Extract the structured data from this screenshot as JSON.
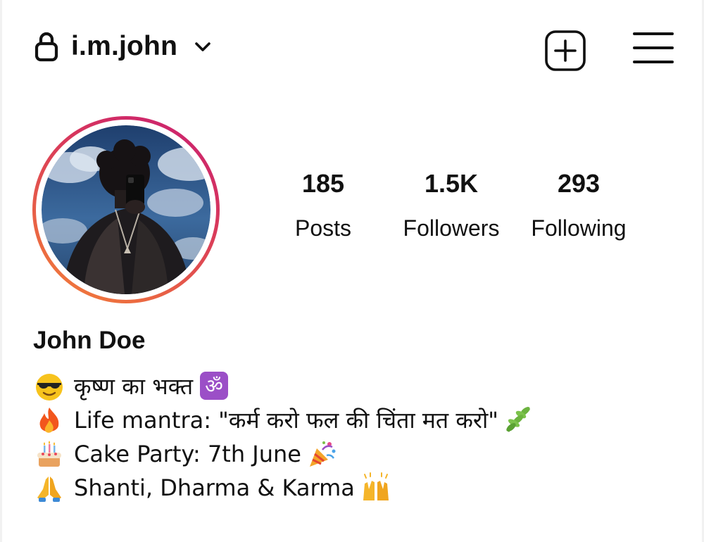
{
  "header": {
    "username": "i.m.john",
    "lock_icon": "lock-icon",
    "dropdown_icon": "chevron-down-icon",
    "create_icon": "plus-square-icon",
    "menu_icon": "hamburger-menu-icon"
  },
  "profile": {
    "avatar_icon": "profile-photo",
    "story_ring_colors": [
      "#c81d73",
      "#ec6b40",
      "#f2853a"
    ],
    "stats": [
      {
        "count": "185",
        "label": "Posts"
      },
      {
        "count": "1.5K",
        "label": "Followers"
      },
      {
        "count": "293",
        "label": "Following"
      }
    ]
  },
  "bio": {
    "name": "John Doe",
    "lines": [
      {
        "emoji": "sunglasses-emoji",
        "text": "कृष्ण का भक्त",
        "end_emoji": "om-emoji"
      },
      {
        "emoji": "fire-emoji",
        "text": "Life mantra: \"कर्म करो फल की चिंता मत करो\"",
        "end_emoji": "herb-emoji"
      },
      {
        "emoji": "birthday-cake-emoji",
        "text": "Cake Party: 7th June",
        "end_emoji": "party-popper-emoji"
      },
      {
        "emoji": "folded-hands-emoji",
        "text": "Shanti, Dharma & Karma",
        "end_emoji": "raised-hands-emoji"
      }
    ]
  }
}
